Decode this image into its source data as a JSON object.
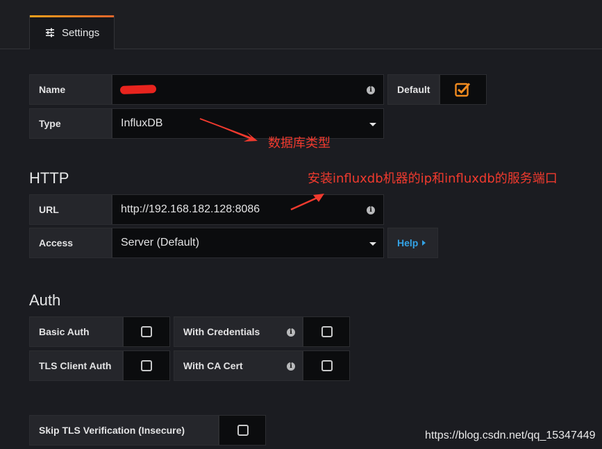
{
  "tabs": [
    {
      "label": "Settings",
      "icon": "sliders-icon",
      "active": true
    }
  ],
  "settings": {
    "name_label": "Name",
    "name_value": "",
    "default_label": "Default",
    "default_checked": true,
    "type_label": "Type",
    "type_value": "InfluxDB"
  },
  "http": {
    "title": "HTTP",
    "url_label": "URL",
    "url_value": "http://192.168.182.128:8086",
    "access_label": "Access",
    "access_value": "Server (Default)",
    "help_label": "Help"
  },
  "auth": {
    "title": "Auth",
    "basic_auth_label": "Basic Auth",
    "basic_auth_checked": false,
    "with_credentials_label": "With Credentials",
    "with_credentials_checked": false,
    "tls_client_auth_label": "TLS Client Auth",
    "tls_client_auth_checked": false,
    "with_ca_cert_label": "With CA Cert",
    "with_ca_cert_checked": false,
    "skip_tls_label": "Skip TLS Verification (Insecure)",
    "skip_tls_checked": false
  },
  "annotations": {
    "db_type": "数据库类型",
    "install_note": "安装influxdb机器的ip和influxdb的服务端口"
  },
  "watermark": "https://blog.csdn.net/qq_15347449",
  "colors": {
    "accent": "#f7a01b",
    "link": "#33a2e5",
    "annotation": "#f03a2e"
  }
}
